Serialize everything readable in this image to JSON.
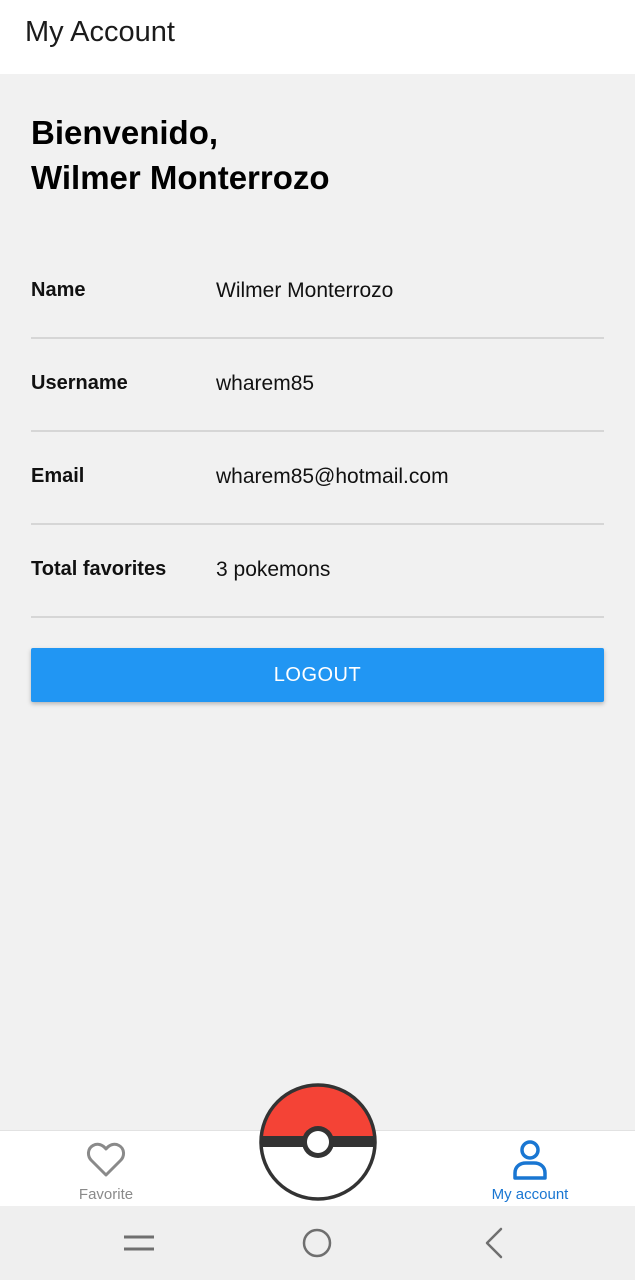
{
  "app_bar": {
    "title": "My Account"
  },
  "welcome": {
    "greeting": "Bienvenido,",
    "name": "Wilmer Monterrozo"
  },
  "profile": {
    "rows": [
      {
        "label": "Name",
        "value": "Wilmer Monterrozo"
      },
      {
        "label": "Username",
        "value": "wharem85"
      },
      {
        "label": "Email",
        "value": "wharem85@hotmail.com"
      },
      {
        "label": "Total favorites",
        "value": "3 pokemons"
      }
    ]
  },
  "logout": {
    "label": "LOGOUT"
  },
  "bottom_nav": {
    "items": [
      {
        "label": "Favorite",
        "icon": "heart-outline-icon",
        "active": false
      },
      {
        "label": "My account",
        "icon": "person-outline-icon",
        "active": true
      }
    ],
    "center_button": {
      "icon": "pokeball-icon"
    }
  },
  "system_nav": {
    "buttons": [
      "menu-icon",
      "home-icon",
      "back-icon"
    ]
  },
  "colors": {
    "accent": "#2196f3",
    "active_nav": "#1976d2",
    "inactive_nav": "#8a8a8a",
    "pokeball_red": "#f44336",
    "background": "#f1f1f1"
  }
}
